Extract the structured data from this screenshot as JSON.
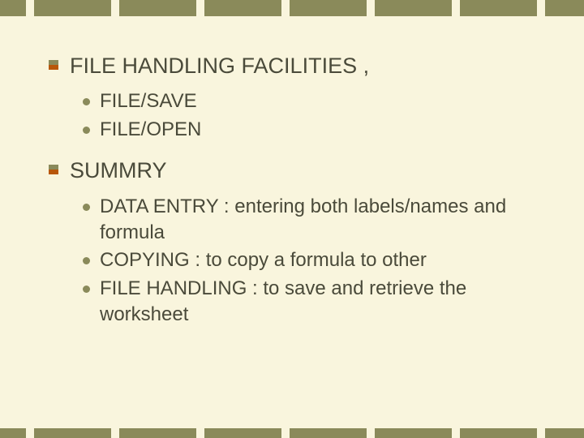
{
  "sections": [
    {
      "title": "FILE HANDLING FACILITIES ,",
      "items": [
        "FILE/SAVE",
        "FILE/OPEN"
      ]
    },
    {
      "title": "SUMMRY",
      "items": [
        "DATA ENTRY : entering both labels/names and formula",
        "COPYING : to copy a formula to other",
        "FILE HANDLING : to save and retrieve the worksheet"
      ]
    }
  ]
}
